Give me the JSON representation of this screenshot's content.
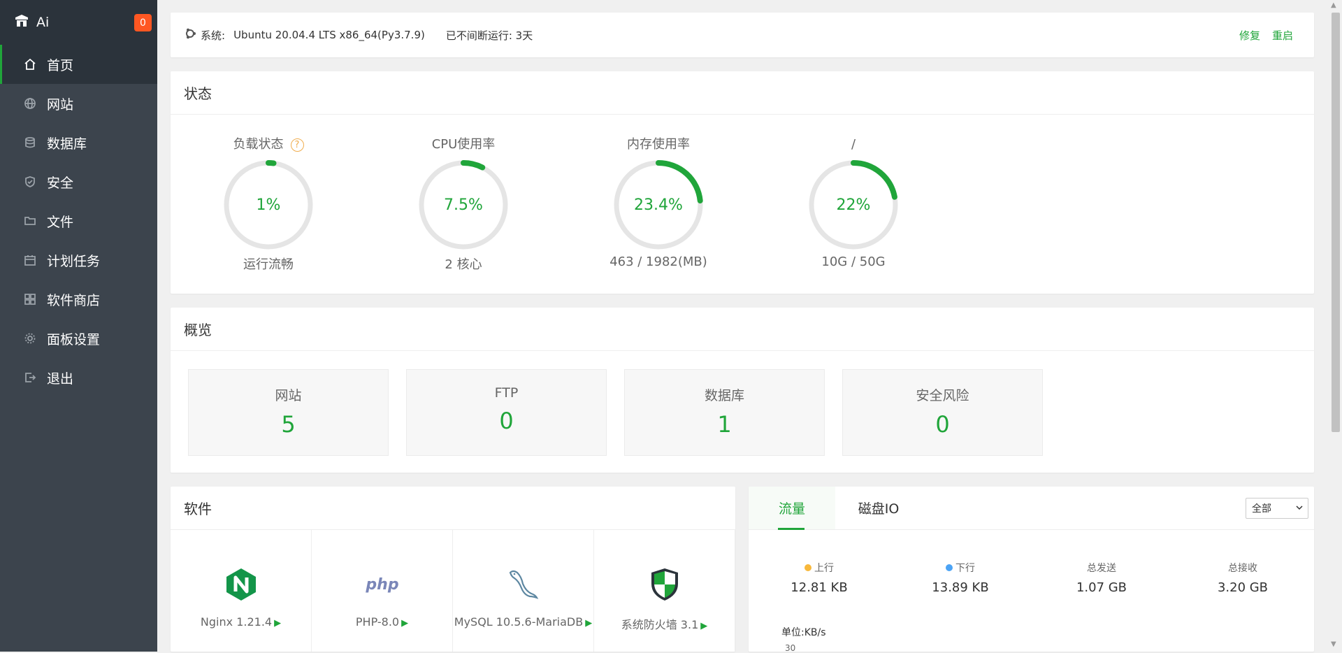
{
  "app": {
    "name": "Ai",
    "notification_count": "0"
  },
  "sidebar": {
    "items": [
      {
        "label": "首页",
        "icon": "home-icon"
      },
      {
        "label": "网站",
        "icon": "globe-icon"
      },
      {
        "label": "数据库",
        "icon": "database-icon"
      },
      {
        "label": "安全",
        "icon": "shield-icon"
      },
      {
        "label": "文件",
        "icon": "folder-icon"
      },
      {
        "label": "计划任务",
        "icon": "calendar-icon"
      },
      {
        "label": "软件商店",
        "icon": "grid-icon"
      },
      {
        "label": "面板设置",
        "icon": "gear-icon"
      },
      {
        "label": "退出",
        "icon": "logout-icon"
      }
    ]
  },
  "system": {
    "label": "系统:",
    "os": "Ubuntu 20.04.4 LTS x86_64(Py3.7.9)",
    "uptime": "已不间断运行: 3天",
    "repair": "修复",
    "restart": "重启"
  },
  "status": {
    "title": "状态",
    "gauges": [
      {
        "title": "负载状态",
        "value": "1%",
        "percent": 1,
        "sub": "运行流畅",
        "help": "?"
      },
      {
        "title": "CPU使用率",
        "value": "7.5%",
        "percent": 7.5,
        "sub": "2 核心"
      },
      {
        "title": "内存使用率",
        "value": "23.4%",
        "percent": 23.4,
        "sub": "463 / 1982(MB)"
      },
      {
        "title": "/",
        "value": "22%",
        "percent": 22,
        "sub": "10G / 50G"
      }
    ]
  },
  "overview": {
    "title": "概览",
    "items": [
      {
        "label": "网站",
        "value": "5"
      },
      {
        "label": "FTP",
        "value": "0"
      },
      {
        "label": "数据库",
        "value": "1"
      },
      {
        "label": "安全风险",
        "value": "0"
      }
    ]
  },
  "software": {
    "title": "软件",
    "items": [
      {
        "name": "Nginx 1.21.4",
        "icon": "nginx-icon"
      },
      {
        "name": "PHP-8.0",
        "icon": "php-icon"
      },
      {
        "name": "MySQL 10.5.6-MariaDB",
        "icon": "mysql-icon"
      },
      {
        "name": "系统防火墙 3.1",
        "icon": "firewall-icon"
      }
    ]
  },
  "traffic": {
    "tabs": [
      "流量",
      "磁盘IO"
    ],
    "select": "全部",
    "stats": [
      {
        "label": "上行",
        "value": "12.81 KB",
        "dot": "#f8b83b"
      },
      {
        "label": "下行",
        "value": "13.89 KB",
        "dot": "#4ba3f5"
      },
      {
        "label": "总发送",
        "value": "1.07 GB"
      },
      {
        "label": "总接收",
        "value": "3.20 GB"
      }
    ],
    "unit": "单位:KB/s",
    "ytick": "30"
  },
  "colors": {
    "accent": "#20a53a",
    "sidebar": "#3c444d",
    "sidebar_dark": "#2b333b",
    "badge": "#ff5722"
  }
}
